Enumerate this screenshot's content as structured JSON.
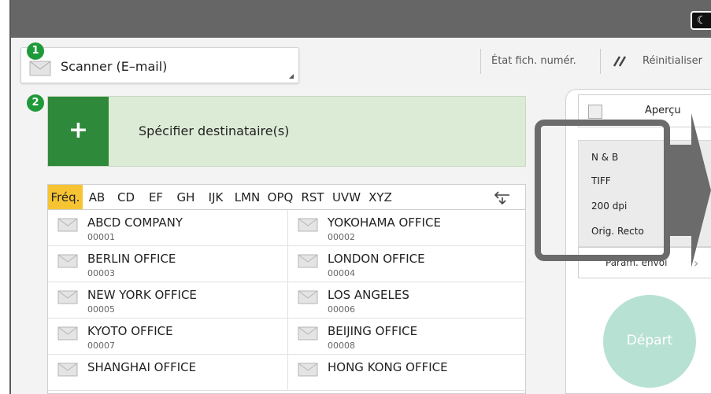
{
  "app": {
    "selector_label": "Scanner (E–mail)"
  },
  "badges": {
    "one": "1",
    "two": "2"
  },
  "header": {
    "scan_status": "État fich. numér.",
    "reset": "Réinitialiser"
  },
  "destination": {
    "plus": "+",
    "label": "Spécifier destinataire(s)"
  },
  "tabs": [
    "Fréq.",
    "AB",
    "CD",
    "EF",
    "GH",
    "IJK",
    "LMN",
    "OPQ",
    "RST",
    "UVW",
    "XYZ"
  ],
  "addresses": [
    {
      "name": "ABCD COMPANY",
      "num": "00001"
    },
    {
      "name": "YOKOHAMA OFFICE",
      "num": "00002"
    },
    {
      "name": "BERLIN OFFICE",
      "num": "00003"
    },
    {
      "name": "LONDON OFFICE",
      "num": "00004"
    },
    {
      "name": "NEW YORK OFFICE",
      "num": "00005"
    },
    {
      "name": "LOS ANGELES",
      "num": "00006"
    },
    {
      "name": "KYOTO OFFICE",
      "num": "00007"
    },
    {
      "name": "BEIJING OFFICE",
      "num": "00008"
    },
    {
      "name": "SHANGHAI  OFFICE",
      "num": ""
    },
    {
      "name": "HONG KONG OFFICE",
      "num": ""
    }
  ],
  "right_panel": {
    "preview": "Aperçu",
    "settings": [
      "N & B",
      "TIFF",
      "200 dpi",
      "Orig. Recto"
    ],
    "param": "Param. envoi",
    "start": "Départ"
  },
  "colors": {
    "accent_green": "#2e8a3a",
    "tab_active": "#f6c433",
    "start": "#b7e1d3"
  },
  "icons": {
    "power": "power-icon",
    "envelope": "envelope-icon",
    "reset": "slash-icon",
    "swap": "swap-icon"
  }
}
